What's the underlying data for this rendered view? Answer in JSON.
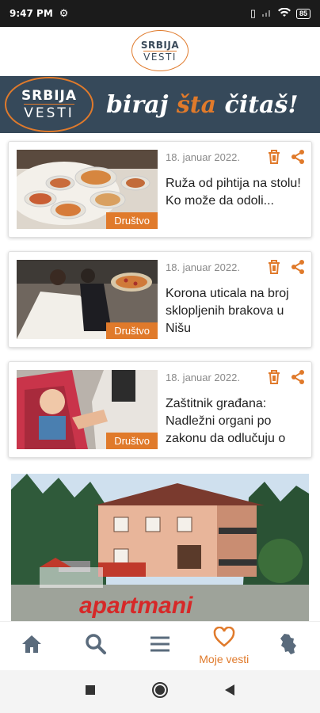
{
  "status_bar": {
    "time": "9:47 PM",
    "battery": "85"
  },
  "header": {
    "logo_line1": "SRBIJA",
    "logo_line2": "VESTI"
  },
  "banner": {
    "logo_line1": "SRBIJA",
    "logo_line2": "VESTI",
    "slogan_part1": "biraj ",
    "slogan_accent": "šta",
    "slogan_part2": " čitaš!"
  },
  "articles": [
    {
      "date": "18. januar 2022.",
      "title": "Ruža od pihtija na stolu! Ko može da odoli...",
      "category": "Društvo"
    },
    {
      "date": "18. januar 2022.",
      "title": "Korona uticala na broj sklopljenih brakova u Nišu",
      "category": "Društvo"
    },
    {
      "date": "18. januar 2022.",
      "title": "Zaštitnik građana: Nadležni organi po zakonu da odlučuju o",
      "category": "Društvo"
    }
  ],
  "ad": {
    "brand": "apartmani"
  },
  "bottom_nav": {
    "items": [
      {
        "icon": "home-icon"
      },
      {
        "icon": "search-icon"
      },
      {
        "icon": "menu-icon"
      },
      {
        "icon": "heart-icon",
        "label": "Moje vesti",
        "active": true
      },
      {
        "icon": "serbia-map-icon"
      }
    ]
  },
  "colors": {
    "accent": "#e07a2b",
    "banner_bg": "#36495a",
    "nav_icon": "#5a6b7c"
  }
}
